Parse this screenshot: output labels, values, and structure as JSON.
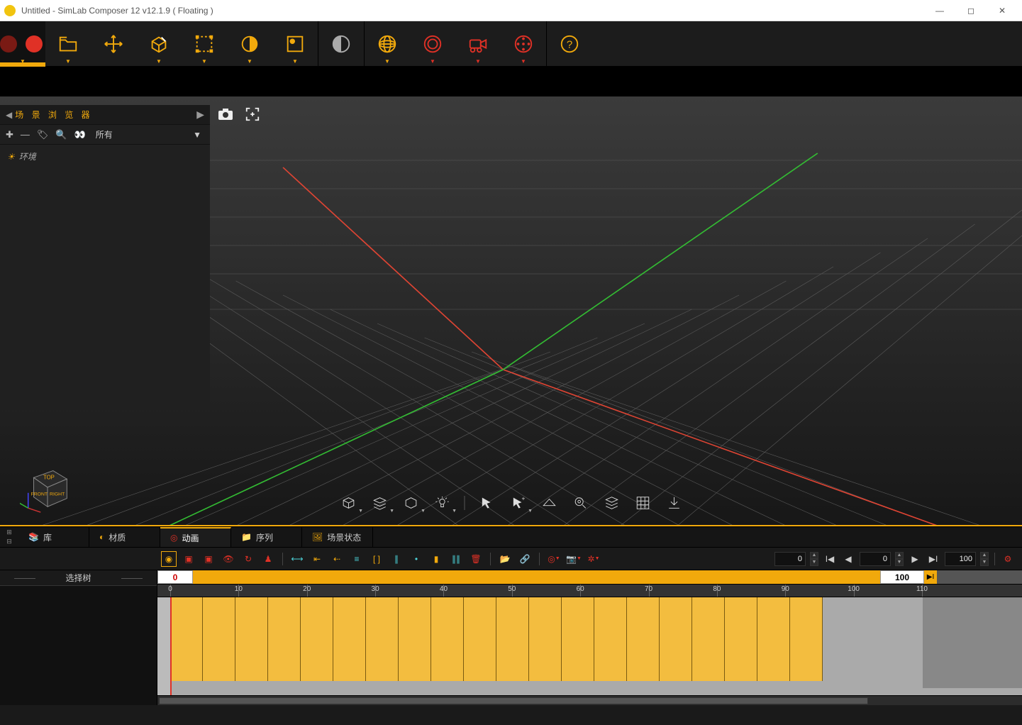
{
  "window": {
    "title": "Untitled - SimLab Composer 12 v12.1.9 ( Floating )"
  },
  "main_toolbar": {
    "items": [
      "record",
      "file",
      "move",
      "edit-cube",
      "selection",
      "appearance",
      "sun-settings",
      "contrast",
      "globe",
      "lens",
      "camera",
      "reel",
      "help"
    ]
  },
  "scene_browser": {
    "title": "场 景 浏 览 器",
    "filter_label": "所有",
    "tree": [
      {
        "icon": "sun",
        "label": "环境"
      }
    ]
  },
  "nav_cube": {
    "top": "TOP",
    "front": "FRONT",
    "right": "RIGHT"
  },
  "viewport_bottom_tools": [
    "cube-mode",
    "layers",
    "primitive",
    "light",
    "pointer",
    "pointer-plus",
    "plane",
    "zoom-extent",
    "stack",
    "grid",
    "download"
  ],
  "bottom_tabs": {
    "items": [
      {
        "icon": "library",
        "label": "库"
      },
      {
        "icon": "material",
        "label": "材质"
      },
      {
        "icon": "animation",
        "label": "动画",
        "active": true
      },
      {
        "icon": "sequence",
        "label": "序列"
      },
      {
        "icon": "scene-state",
        "label": "场景状态"
      }
    ]
  },
  "anim_toolbar": {
    "left_icons": [
      "eye-key",
      "cube-red",
      "cube-pair",
      "eye",
      "cycle",
      "chair"
    ],
    "mid_icons": [
      "range",
      "skip-back",
      "step-back",
      "bars1",
      "bracket",
      "bars2",
      "dot",
      "bar-v",
      "bars-cyan",
      "trash"
    ],
    "right_icons": [
      "add-folder",
      "link",
      "rings",
      "camera-drop",
      "reel-drop"
    ]
  },
  "playback": {
    "start_frame": "0",
    "end_frame": "100",
    "display_end": "100"
  },
  "timeline": {
    "tree_header": "选择树",
    "range_start": "0",
    "range_end": "100",
    "ruler_ticks": [
      "0",
      "10",
      "20",
      "30",
      "40",
      "50",
      "60",
      "70",
      "80",
      "90",
      "100",
      "110"
    ]
  }
}
